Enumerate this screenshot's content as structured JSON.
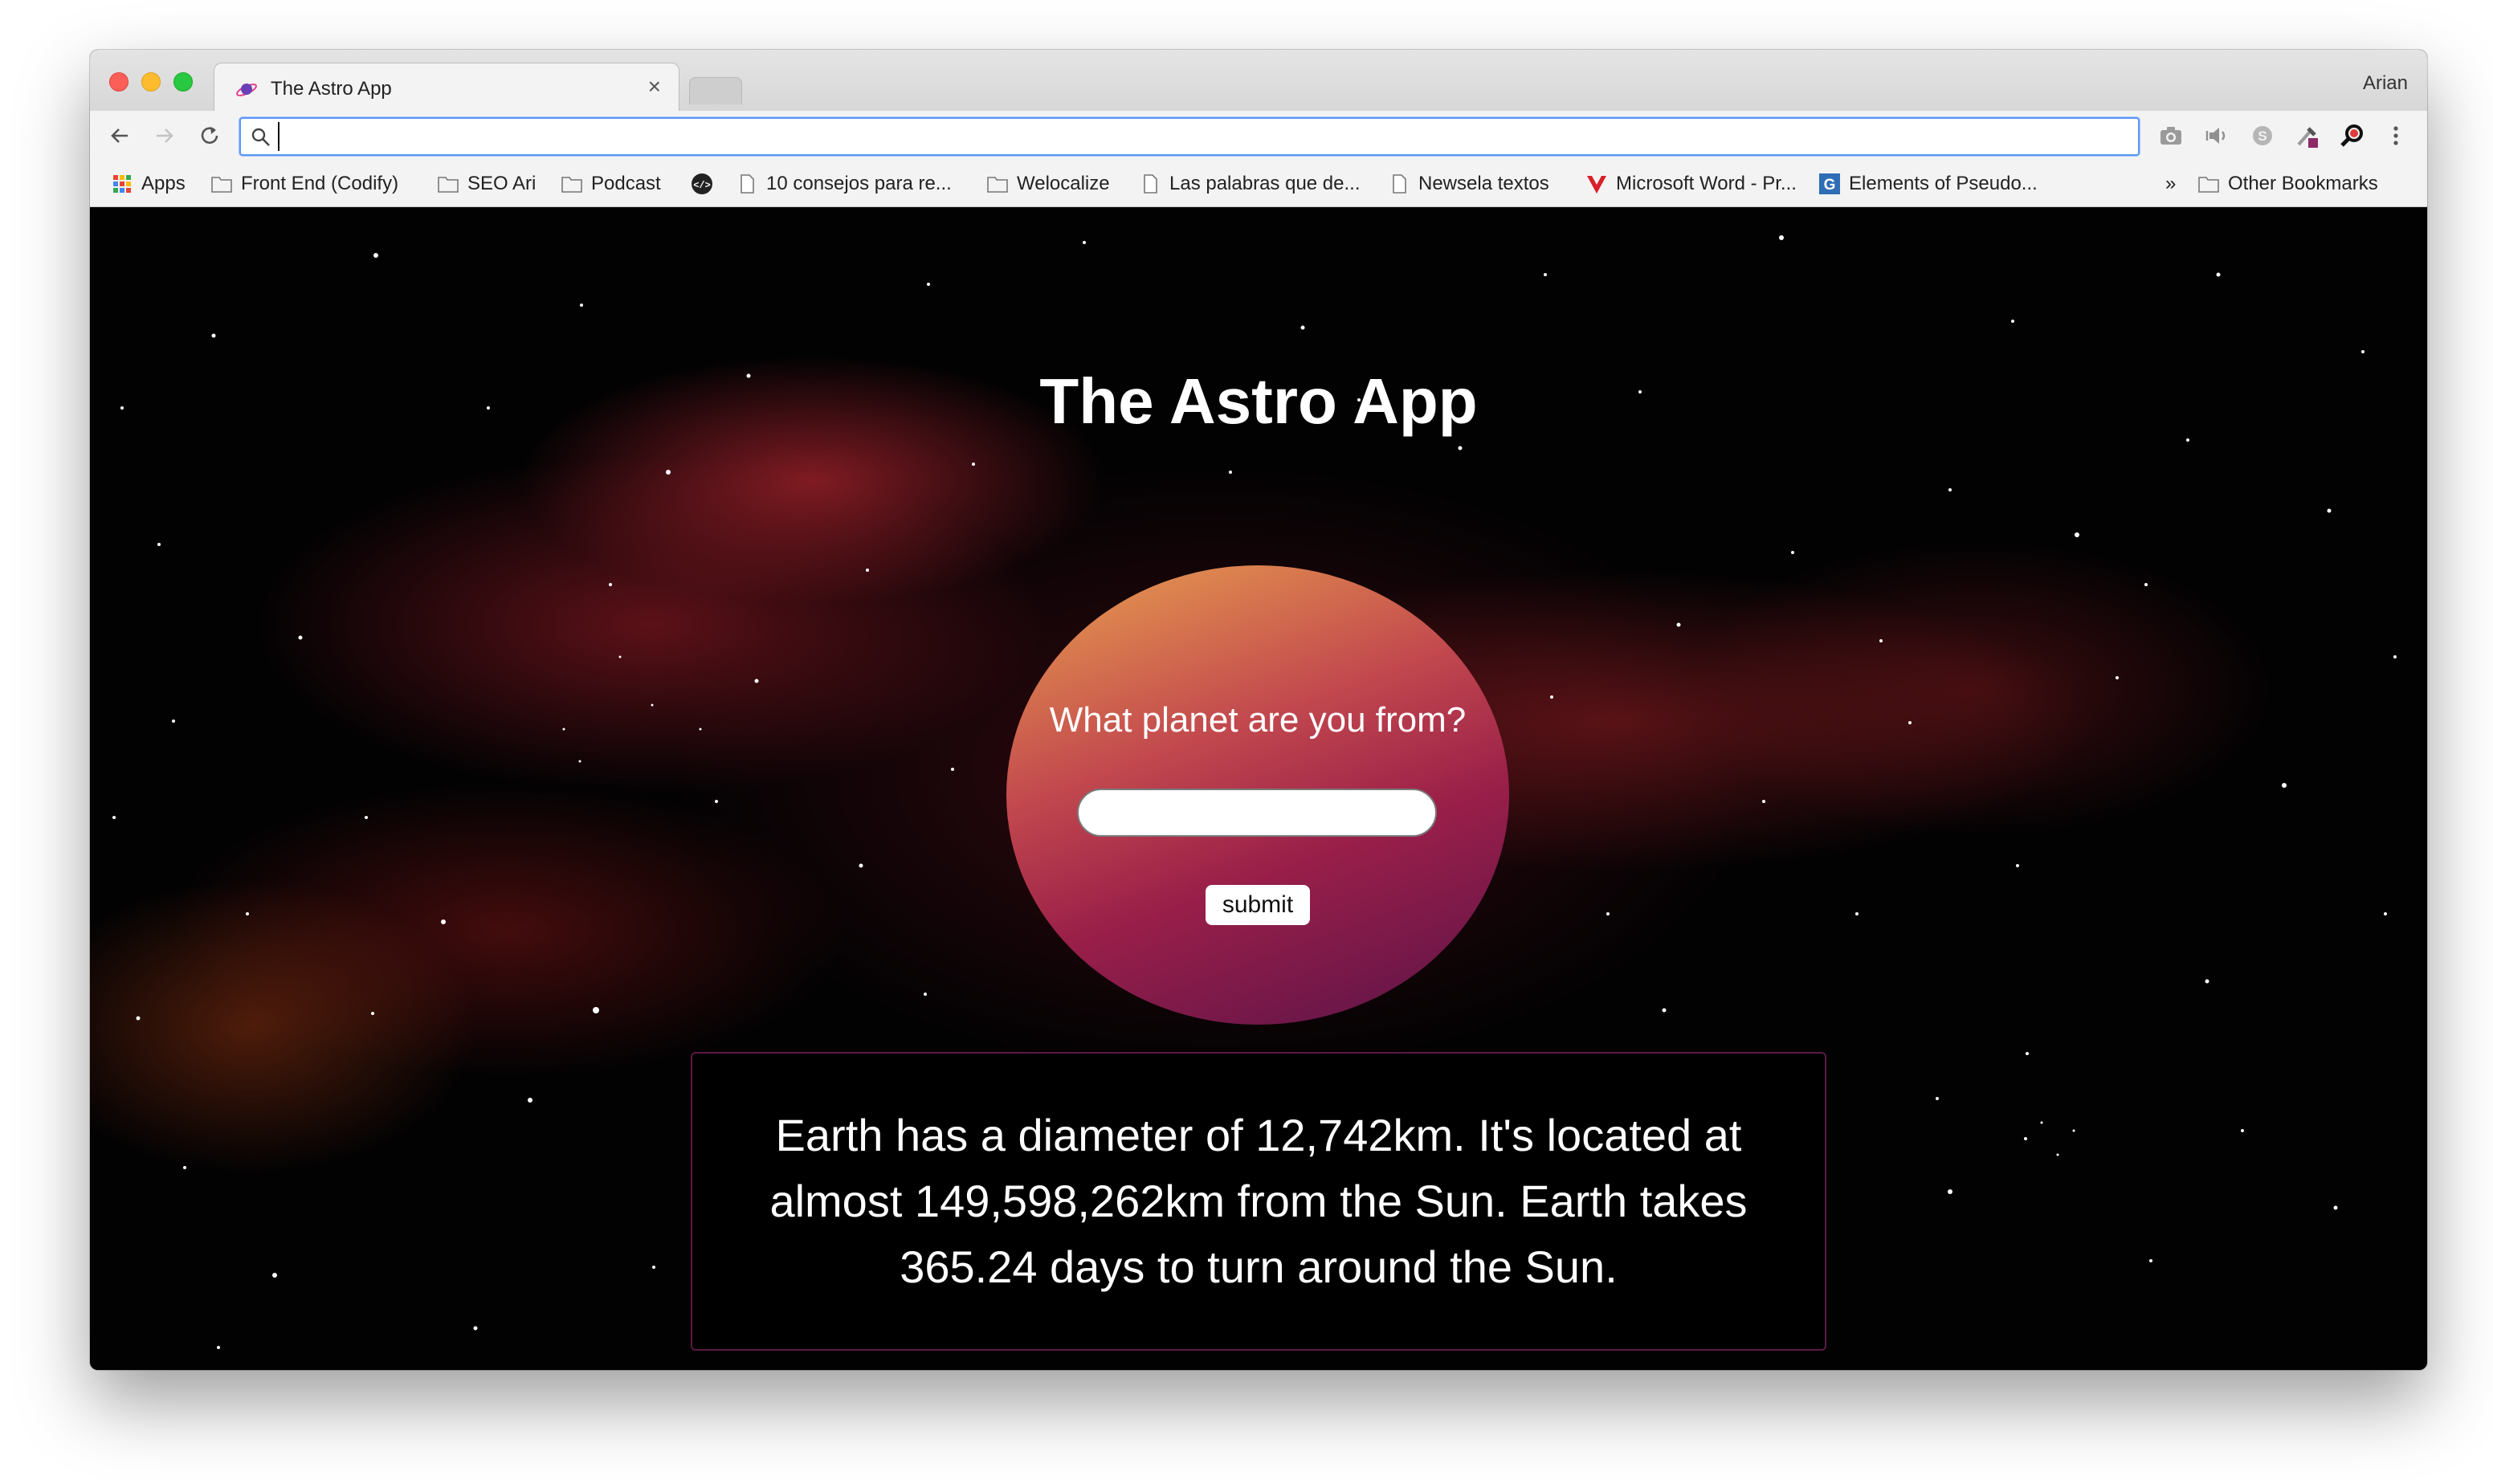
{
  "browser": {
    "tab_title": "The Astro App",
    "tab_close": "×",
    "profile_name": "Arian",
    "address_value": "",
    "bookmarks": [
      {
        "label": "Apps",
        "icon": "apps-grid-icon"
      },
      {
        "label": "Front End (Codify)",
        "icon": "folder-icon"
      },
      {
        "label": "SEO Ari",
        "icon": "folder-icon"
      },
      {
        "label": "Podcast",
        "icon": "folder-icon"
      },
      {
        "label": "",
        "icon": "code-icon"
      },
      {
        "label": "10 consejos para re...",
        "icon": "page-icon"
      },
      {
        "label": "Welocalize",
        "icon": "folder-icon"
      },
      {
        "label": "Las palabras que de...",
        "icon": "page-icon"
      },
      {
        "label": "Newsela textos",
        "icon": "page-icon"
      },
      {
        "label": "Microsoft Word - Pr...",
        "icon": "vivaldi-icon"
      },
      {
        "label": "Elements of Pseudo...",
        "icon": "g-icon"
      }
    ],
    "overflow": "»",
    "other_bookmarks": "Other Bookmarks"
  },
  "app": {
    "title": "The Astro App",
    "question": "What planet are you from?",
    "input_value": "",
    "submit_label": "submit",
    "result": "Earth has a diameter of 12,742km. It's located at almost 149,598,262km from the Sun. Earth takes 365.24 days to turn around the Sun."
  },
  "colors": {
    "accent": "#5e97f6",
    "planet_gradient": [
      "#e9a14f",
      "#c2484e",
      "#9a1f49",
      "#5a1349"
    ],
    "info_border": "#5a1a44"
  }
}
